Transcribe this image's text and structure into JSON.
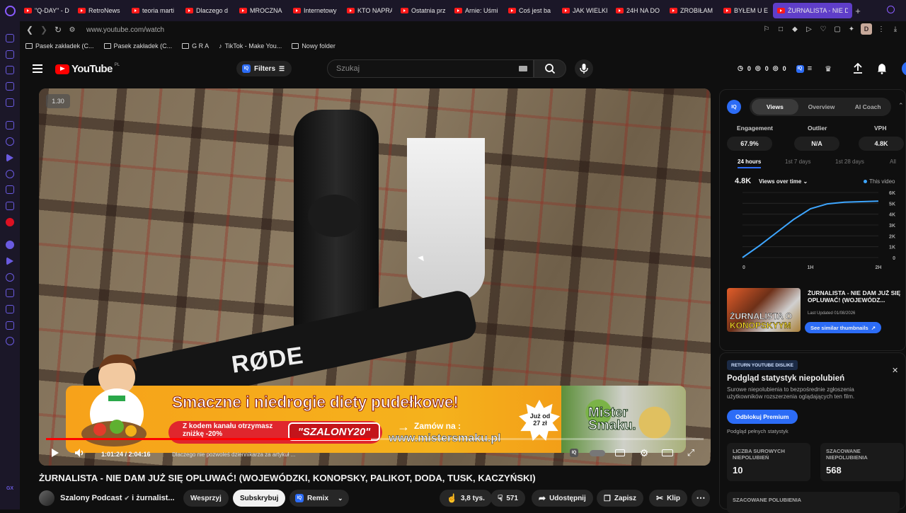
{
  "tabs": [
    {
      "title": "\"Q-DAY\" - D"
    },
    {
      "title": "RetroNews"
    },
    {
      "title": "teoria marti"
    },
    {
      "title": "Dlaczego d"
    },
    {
      "title": "MROCZNA"
    },
    {
      "title": "Internetowy"
    },
    {
      "title": "KTO NAPRA"
    },
    {
      "title": "Ostatnia prz"
    },
    {
      "title": "Arnie: Uśmi"
    },
    {
      "title": "Coś jest ba"
    },
    {
      "title": "JAK WIELKI"
    },
    {
      "title": "24H NA DO"
    },
    {
      "title": "ZROBIŁAM"
    },
    {
      "title": "BYŁEM U E"
    },
    {
      "title": "ŻURNALISTA - NIE DA"
    }
  ],
  "address": {
    "url": "www.youtube.com/watch",
    "profile_initial": "D"
  },
  "bookmarks": [
    {
      "label": "Pasek zakładek (C..."
    },
    {
      "label": "Pasek zakładek (C..."
    },
    {
      "label": "G R A"
    },
    {
      "label": "TikTok - Make You..."
    },
    {
      "label": "Nowy folder"
    }
  ],
  "sidebar": {
    "gx_label": "GX"
  },
  "yt_header": {
    "logo_text": "YouTube",
    "region": "PL",
    "filters_label": "Filters",
    "filters_badge": "IQ",
    "search_placeholder": "Szukaj",
    "counters": [
      "0",
      "0",
      "0"
    ]
  },
  "player": {
    "speed": "1.30",
    "time": "1:01:24 / 2:04:16",
    "chapter": "Dlaczego nie pozwoleś dziennikarza za artykuł ...",
    "progress": 0.494,
    "mic_brand": "RØDE"
  },
  "ad": {
    "headline": "Smaczne i niedrogie diety pudełkowe!",
    "code_text": "Z kodem kanału otrzymasz zniżkę -20%",
    "code": "\"SZALONY20\"",
    "order_label": "Zamów na :",
    "site": "www.mistersmaku.pl",
    "price": "Już od 27 zł",
    "brand": "Mister Smaku."
  },
  "video": {
    "title": "ŻURNALISTA - NIE DAM JUŻ SIĘ OPLUWAĆ! (WOJEWÓDZKI, KONOPSKY, PALIKOT, DODA, TUSK, KACZYŃSKI)",
    "channel": "Szalony Podcast",
    "channel_suffix": "i żurnalist...",
    "join_label": "Wesprzyj",
    "subscribe_label": "Subskrybuj",
    "remix_label": "Remix",
    "likes": "3,8 tys.",
    "dislikes": "571",
    "share_label": "Udostępnij",
    "save_label": "Zapisz",
    "clip_label": "Klip"
  },
  "vidiq": {
    "logo": "IQ",
    "tabs": [
      "Views",
      "Overview",
      "AI Coach"
    ],
    "metrics": [
      {
        "label": "Engagement",
        "value": "67.9%"
      },
      {
        "label": "Outlier",
        "value": "N/A"
      },
      {
        "label": "VPH",
        "value": "4.8K"
      }
    ],
    "ranges": [
      "24 hours",
      "1st 7 days",
      "1st 28 days",
      "All"
    ],
    "views_total": "4.8K",
    "chart_selector": "Views over time",
    "legend": "This video",
    "thumb_title": "ŻURNALISTA - NIE DAM JUŻ SIĘ OPLUWAĆ! (WOJEWÓDZ...",
    "thumb_text_1": "ŻURNALISTA O",
    "thumb_text_2": "KONOPSKYYM",
    "last_updated": "Last Updated 01/08/2026",
    "similar_btn": "See similar thumbnails"
  },
  "chart_data": {
    "type": "line",
    "x": [
      0,
      0.25,
      0.5,
      0.75,
      1.0,
      1.25,
      1.5,
      1.75,
      2.0
    ],
    "xticks": [
      "0",
      "1H",
      "2H"
    ],
    "xtick_values": [
      0,
      1,
      2
    ],
    "yticks": [
      "0",
      "1K",
      "2K",
      "3K",
      "4K",
      "5K",
      "6K"
    ],
    "ylim": [
      0,
      6000
    ],
    "series": [
      {
        "name": "This video",
        "values": [
          0,
          1100,
          2300,
          3500,
          4500,
          4950,
          5100,
          5150,
          5200
        ]
      }
    ],
    "color": "#3ea6ff"
  },
  "dislikes_panel": {
    "badge": "RETURN YOUTUBE DISLIKE",
    "title": "Podgląd statystyk niepolubień",
    "subtitle": "Surowe niepolubienia to bezpośrednie zgłoszenia użytkowników rozszerzenia oglądających ten film.",
    "button": "Odblokuj Premium",
    "note": "Podgląd pełnych statystyk",
    "raw_label": "LICZBA SUROWYCH NIEPOLUBIEŃ",
    "raw_value": "10",
    "est_label": "SZACOWANE NIEPOLUBIENIA",
    "est_value": "568",
    "likes_label": "SZACOWANE POLUBIENIA"
  },
  "colors": {
    "accent": "#2c6cf6",
    "tab_active": "#5f3ec9",
    "yt_red": "#ff0000",
    "chart_line": "#3ea6ff"
  }
}
